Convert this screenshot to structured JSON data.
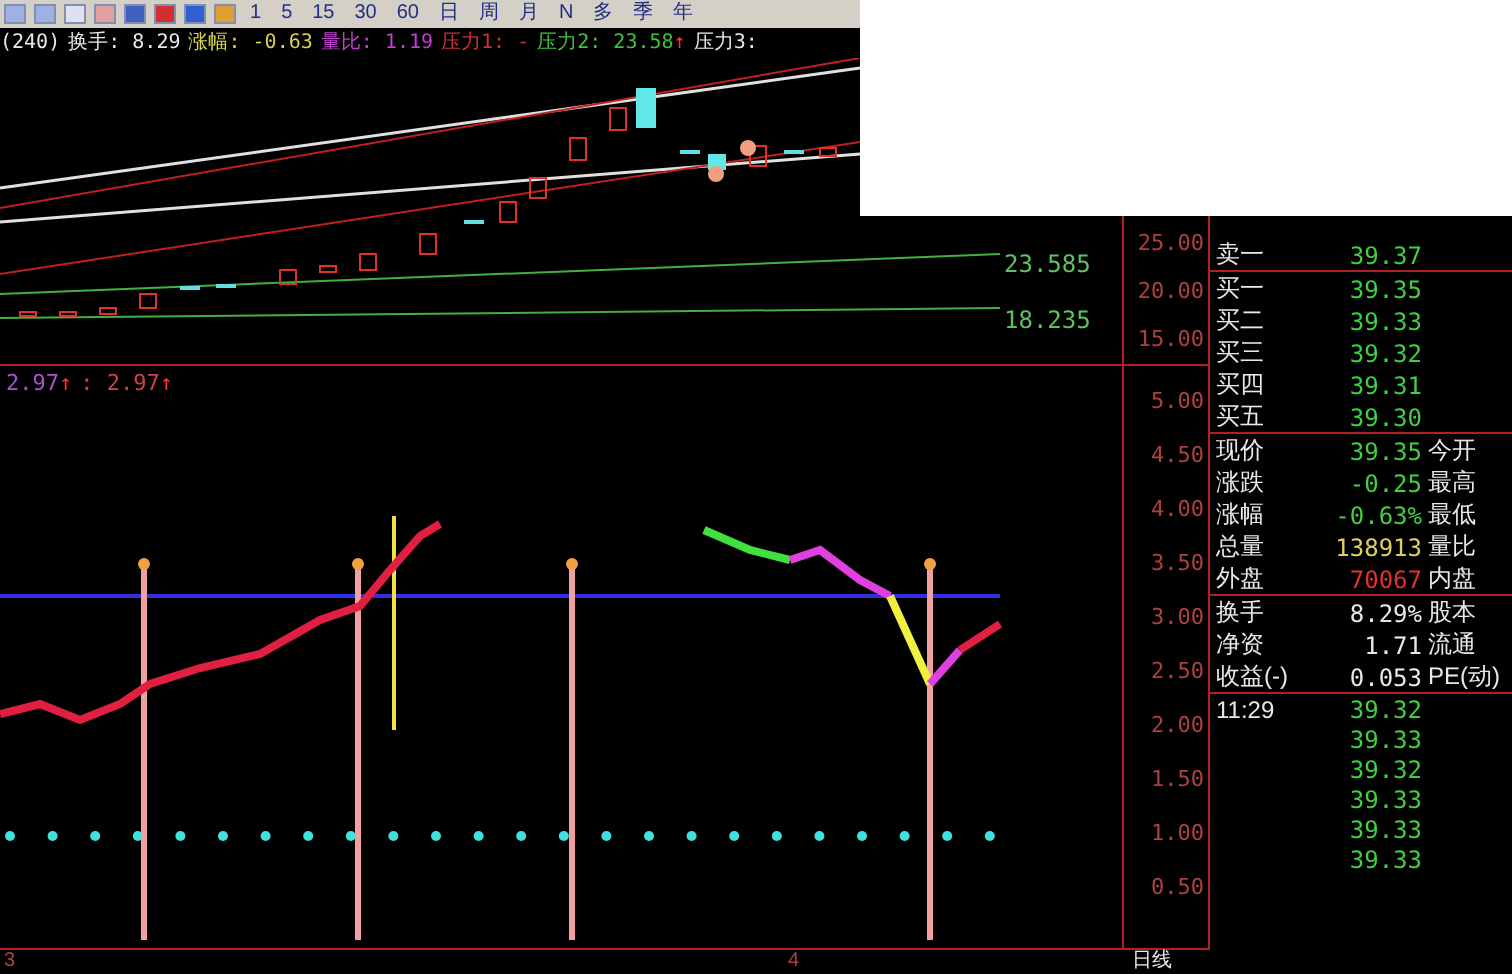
{
  "toolbar": {
    "periods": [
      "1",
      "5",
      "15",
      "30",
      "60",
      "日",
      "周",
      "月",
      "N",
      "多",
      "季",
      "年"
    ]
  },
  "info": {
    "items": [
      {
        "text": "(240)",
        "color": "#e8e8e8"
      },
      {
        "text": "换手: 8.29",
        "color": "#e8e8e8"
      },
      {
        "text": "涨幅: -0.63",
        "color": "#d8d050"
      },
      {
        "text": "量比: 1.19",
        "color": "#c040d0"
      },
      {
        "text": "压力1: -",
        "color": "#d03030"
      },
      {
        "text": "压力2: 23.58",
        "color": "#40c040",
        "mark": "↑"
      },
      {
        "text": "压力3:",
        "color": "#e8e8e8"
      }
    ]
  },
  "chart": {
    "line_labels": [
      "23.585",
      "18.235"
    ]
  },
  "price_axis": [
    "25.00",
    "20.00",
    "15.00"
  ],
  "indicator": {
    "header": [
      {
        "text": "2.97",
        "color": "#b050d0",
        "mark": "↑"
      },
      {
        "text": ": 2.97",
        "color": "#d04050",
        "mark": "↑"
      }
    ]
  },
  "indicator_axis": [
    "5.00",
    "4.50",
    "4.00",
    "3.50",
    "3.00",
    "2.50",
    "2.00",
    "1.50",
    "1.00",
    "0.50"
  ],
  "time_axis": [
    "3",
    "4"
  ],
  "period": "日线",
  "quote": {
    "sections": [
      {
        "rows": [
          {
            "label": "卖一",
            "value": "39.37",
            "color": "#40d040"
          }
        ]
      },
      {
        "rows": [
          {
            "label": "买一",
            "value": "39.35",
            "color": "#40d040"
          },
          {
            "label": "买二",
            "value": "39.33",
            "color": "#40d040"
          },
          {
            "label": "买三",
            "value": "39.32",
            "color": "#40d040"
          },
          {
            "label": "买四",
            "value": "39.31",
            "color": "#40d040"
          },
          {
            "label": "买五",
            "value": "39.30",
            "color": "#40d040"
          }
        ]
      },
      {
        "rows": [
          {
            "label": "现价",
            "value": "39.35",
            "color": "#40d040",
            "label2": "今开"
          },
          {
            "label": "涨跌",
            "value": "-0.25",
            "color": "#40d040",
            "label2": "最高"
          },
          {
            "label": "涨幅",
            "value": "-0.63%",
            "color": "#40d040",
            "label2": "最低"
          },
          {
            "label": "总量",
            "value": "138913",
            "color": "#e0d060",
            "label2": "量比"
          },
          {
            "label": "外盘",
            "value": "70067",
            "color": "#e03030",
            "label2": "内盘"
          }
        ]
      },
      {
        "rows": [
          {
            "label": "换手",
            "value": "8.29%",
            "color": "#e8e8e8",
            "label2": "股本"
          },
          {
            "label": "净资",
            "value": "1.71",
            "color": "#e8e8e8",
            "label2": "流通"
          },
          {
            "label": "收益(-)",
            "value": "0.053",
            "color": "#e8e8e8",
            "label2": "PE(动)"
          }
        ]
      }
    ],
    "ticks": {
      "time": "11:29",
      "prices": [
        "39.32",
        "39.33",
        "39.32",
        "39.33",
        "39.33",
        "39.33"
      ]
    }
  }
}
